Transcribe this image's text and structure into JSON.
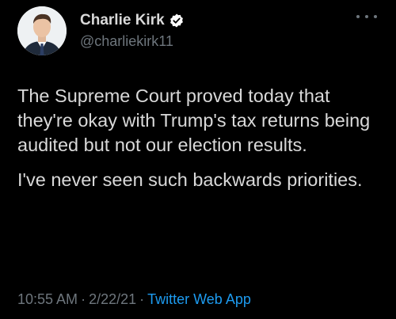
{
  "user": {
    "display_name": "Charlie Kirk",
    "handle": "@charliekirk11",
    "verified": true
  },
  "tweet": {
    "paragraphs": [
      "The Supreme Court proved today that they're okay with Trump's tax returns being audited but not our election results.",
      "I've never seen such backwards priorities."
    ]
  },
  "meta": {
    "time": "10:55 AM",
    "separator": "·",
    "date": "2/22/21",
    "source": "Twitter Web App"
  },
  "colors": {
    "background": "#000000",
    "text": "#d9d9d9",
    "secondary": "#6e767d",
    "link": "#1d9bf0",
    "verified_badge": "#ffffff"
  },
  "icons": {
    "avatar": "profile-photo",
    "verified": "verified-badge-icon",
    "more": "more-options-icon"
  }
}
